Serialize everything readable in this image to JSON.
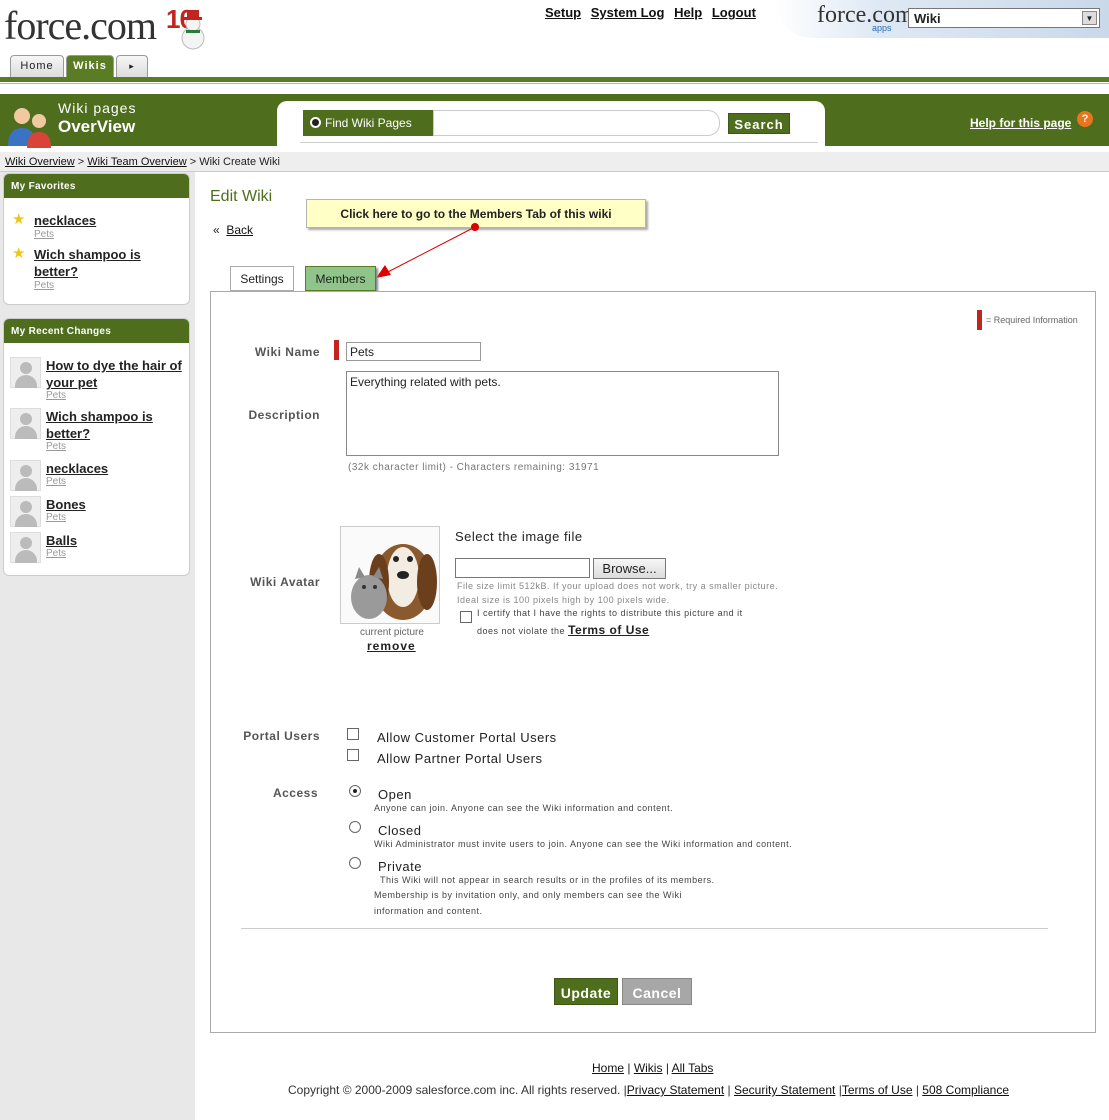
{
  "header": {
    "logo_text": "force.com",
    "logo_ten": "10",
    "links": [
      "Setup",
      "System Log",
      "Help",
      "Logout"
    ],
    "app_brand": "force.com",
    "app_brand_sub": "apps",
    "app_selector_value": "Wiki"
  },
  "tabs": [
    {
      "label": "Home"
    },
    {
      "label": "Wikis"
    },
    {
      "label": "▸"
    }
  ],
  "banner": {
    "title_line1": "Wiki pages",
    "title_line2": "OverView",
    "search_label": "Find Wiki Pages",
    "search_value": "",
    "search_button": "Search",
    "help_link": "Help for this page",
    "help_icon": "?"
  },
  "breadcrumb": {
    "items": [
      "Wiki Overview",
      "Wiki Team Overview",
      "Wiki Create Wiki"
    ],
    "separator": ">"
  },
  "sidebar": {
    "favorites_title": "My Favorites",
    "favorites": [
      {
        "title": "necklaces",
        "category": "Pets"
      },
      {
        "title": "Wich shampoo is better?",
        "category": "Pets"
      }
    ],
    "recent_title": "My Recent Changes",
    "recent": [
      {
        "title": "How to dye the hair of your pet",
        "category": "Pets"
      },
      {
        "title": "Wich shampoo is better?",
        "category": "Pets"
      },
      {
        "title": "necklaces",
        "category": "Pets"
      },
      {
        "title": "Bones",
        "category": "Pets"
      },
      {
        "title": "Balls",
        "category": "Pets"
      }
    ]
  },
  "main": {
    "title": "Edit Wiki",
    "back_arrow": "«",
    "back_label": "Back",
    "callout": "Click here to go to the Members Tab of this wiki",
    "tabs": [
      {
        "label": "Settings"
      },
      {
        "label": "Members"
      }
    ],
    "required_note": "= Required Information",
    "form": {
      "wiki_name_label": "Wiki Name",
      "wiki_name_value": "Pets",
      "description_label": "Description",
      "description_value": "Everything related with pets.",
      "char_limit_note": "(32k character limit) - Characters remaining:  31971",
      "avatar_label": "Wiki Avatar",
      "current_picture": "current picture",
      "remove_label": "remove",
      "select_image": "Select the image file",
      "browse_label": "Browse...",
      "file_note1": "File size limit 512kB. If your upload does not work, try a smaller picture.",
      "file_note2": "Ideal size is 100 pixels high by 100 pixels wide.",
      "certify_text1": "I certify that I have the rights to distribute this picture and it",
      "certify_text2": "does not violate the",
      "terms_link": "Terms of Use",
      "portal_label": "Portal Users",
      "portal_options": [
        "Allow Customer Portal Users",
        "Allow Partner Portal Users"
      ],
      "access_label": "Access",
      "access_selected": "Open",
      "access_options": [
        {
          "label": "Open",
          "note": "Anyone can join. Anyone can see the Wiki information and content."
        },
        {
          "label": "Closed",
          "note": "Wiki Administrator must invite users to join. Anyone can see the Wiki information and content."
        },
        {
          "label": "Private",
          "note": "This Wiki will not appear in search results or in the profiles of its members.",
          "note2": "Membership is by invitation only, and only members can see the Wiki",
          "note3": "information and content."
        }
      ],
      "update_button": "Update",
      "cancel_button": "Cancel"
    }
  },
  "footer": {
    "links": [
      "Home",
      "Wikis",
      "All Tabs"
    ],
    "copyright": "Copyright © 2000-2009 salesforce.com inc. All rights reserved.",
    "legal_links": [
      "Privacy Statement",
      "Security Statement",
      "Terms of Use",
      "508 Compliance"
    ]
  },
  "colors": {
    "brand_green": "#4e6e1d",
    "members_tab": "#8fc48a",
    "required": "#c0251e",
    "callout_bg": "#ffffc6"
  }
}
